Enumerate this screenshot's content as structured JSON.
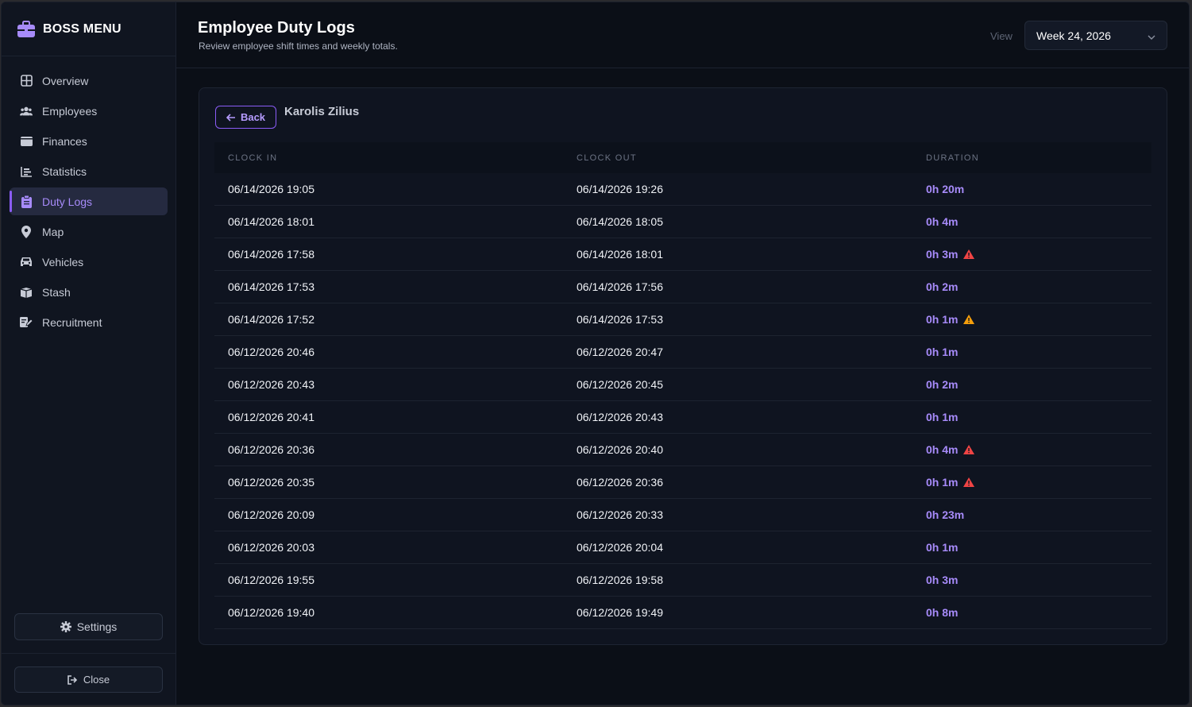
{
  "app": {
    "brand_title": "BOSS MENU"
  },
  "sidebar": {
    "items": [
      {
        "label": "Overview",
        "icon": "grid-icon"
      },
      {
        "label": "Employees",
        "icon": "users-icon"
      },
      {
        "label": "Finances",
        "icon": "wallet-icon"
      },
      {
        "label": "Statistics",
        "icon": "chart-icon"
      },
      {
        "label": "Duty Logs",
        "icon": "clipboard-icon",
        "active": true
      },
      {
        "label": "Map",
        "icon": "map-pin-icon"
      },
      {
        "label": "Vehicles",
        "icon": "car-icon"
      },
      {
        "label": "Stash",
        "icon": "box-icon"
      },
      {
        "label": "Recruitment",
        "icon": "edit-icon"
      }
    ],
    "settings_label": "Settings",
    "close_label": "Close"
  },
  "header": {
    "title": "Employee Duty Logs",
    "subtitle": "Review employee shift times and weekly totals.",
    "view_label": "View",
    "week_value": "Week 24, 2026"
  },
  "detail": {
    "back_label": "Back",
    "employee_name": "Karolis Zilius"
  },
  "table": {
    "headers": [
      "CLOCK IN",
      "CLOCK OUT",
      "DURATION"
    ],
    "rows": [
      {
        "clock_in": "06/14/2026 19:05",
        "clock_out": "06/14/2026 19:26",
        "duration": "0h 20m",
        "warning": ""
      },
      {
        "clock_in": "06/14/2026 18:01",
        "clock_out": "06/14/2026 18:05",
        "duration": "0h 4m",
        "warning": ""
      },
      {
        "clock_in": "06/14/2026 17:58",
        "clock_out": "06/14/2026 18:01",
        "duration": "0h 3m",
        "warning": "red"
      },
      {
        "clock_in": "06/14/2026 17:53",
        "clock_out": "06/14/2026 17:56",
        "duration": "0h 2m",
        "warning": ""
      },
      {
        "clock_in": "06/14/2026 17:52",
        "clock_out": "06/14/2026 17:53",
        "duration": "0h 1m",
        "warning": "orange"
      },
      {
        "clock_in": "06/12/2026 20:46",
        "clock_out": "06/12/2026 20:47",
        "duration": "0h 1m",
        "warning": ""
      },
      {
        "clock_in": "06/12/2026 20:43",
        "clock_out": "06/12/2026 20:45",
        "duration": "0h 2m",
        "warning": ""
      },
      {
        "clock_in": "06/12/2026 20:41",
        "clock_out": "06/12/2026 20:43",
        "duration": "0h 1m",
        "warning": ""
      },
      {
        "clock_in": "06/12/2026 20:36",
        "clock_out": "06/12/2026 20:40",
        "duration": "0h 4m",
        "warning": "red"
      },
      {
        "clock_in": "06/12/2026 20:35",
        "clock_out": "06/12/2026 20:36",
        "duration": "0h 1m",
        "warning": "red"
      },
      {
        "clock_in": "06/12/2026 20:09",
        "clock_out": "06/12/2026 20:33",
        "duration": "0h 23m",
        "warning": ""
      },
      {
        "clock_in": "06/12/2026 20:03",
        "clock_out": "06/12/2026 20:04",
        "duration": "0h 1m",
        "warning": ""
      },
      {
        "clock_in": "06/12/2026 19:55",
        "clock_out": "06/12/2026 19:58",
        "duration": "0h 3m",
        "warning": ""
      },
      {
        "clock_in": "06/12/2026 19:40",
        "clock_out": "06/12/2026 19:49",
        "duration": "0h 8m",
        "warning": ""
      }
    ]
  },
  "colors": {
    "accent": "#8b5cf6",
    "accent_text": "#a78bfa",
    "warning_red": "#ef4444",
    "warning_orange": "#f59e0b",
    "background": "#0b0f17"
  }
}
